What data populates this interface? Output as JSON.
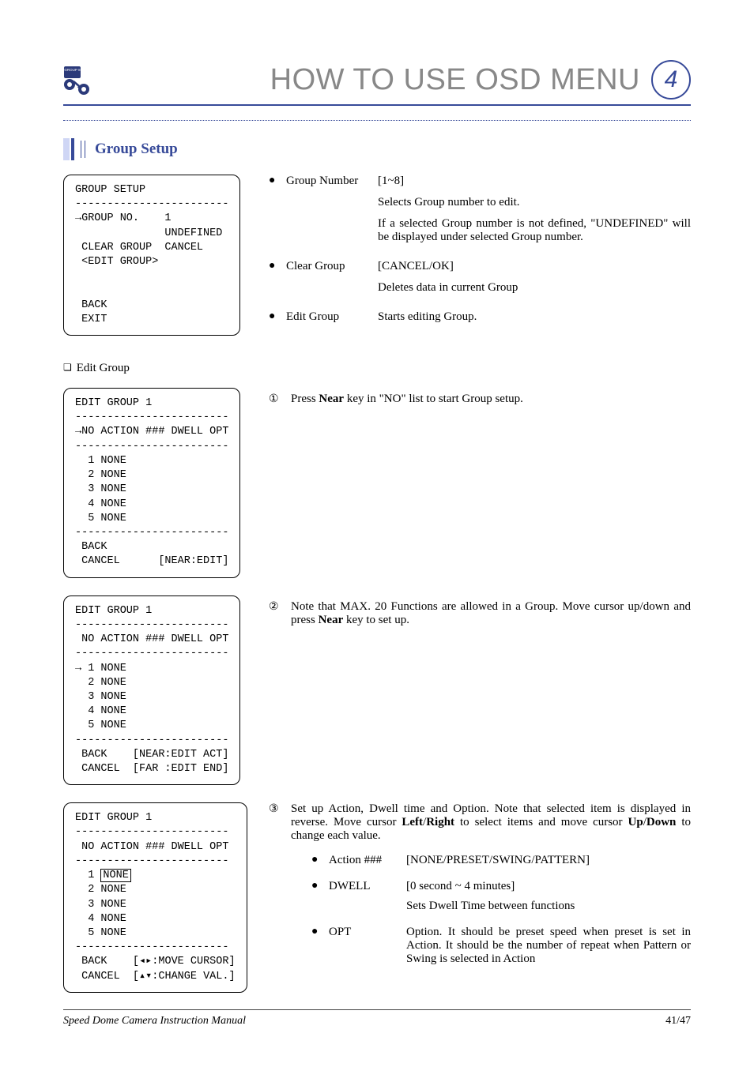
{
  "header": {
    "title": "HOW TO USE OSD MENU",
    "chapter_number": "4",
    "icon_name": "group-8-icon"
  },
  "section": {
    "title": "Group Setup"
  },
  "osd_group_setup": {
    "title": "GROUP SETUP",
    "rule": "------------------------",
    "row_no": "→GROUP NO.    1",
    "row_undef": "              UNDEFINED",
    "row_clear": " CLEAR GROUP  CANCEL",
    "row_edit": " <EDIT GROUP>",
    "row_back": " BACK",
    "row_exit": " EXIT"
  },
  "group_desc": {
    "items": [
      {
        "label": "Group Number",
        "value_line": "[1~8]",
        "p1": "Selects Group number to edit.",
        "p2": "If a selected  Group number is not defined, \"UNDEFINED\" will be displayed under selected Group number."
      },
      {
        "label": "Clear Group",
        "value_line": "[CANCEL/OK]",
        "p1": "Deletes data in current Group"
      },
      {
        "label": "Edit Group",
        "value_line": "Starts editing Group."
      }
    ]
  },
  "subheading": "Edit Group",
  "osd_edit1": {
    "title": "EDIT GROUP 1",
    "rule": "------------------------",
    "hdr": "→NO ACTION ### DWELL OPT",
    "rows": "  1 NONE\n  2 NONE\n  3 NONE\n  4 NONE\n  5 NONE",
    "back": " BACK",
    "cancel": " CANCEL      [NEAR:EDIT]"
  },
  "osd_edit2": {
    "title": "EDIT GROUP 1",
    "rule": "------------------------",
    "hdr": " NO ACTION ### DWELL OPT",
    "rows": "→ 1 NONE\n  2 NONE\n  3 NONE\n  4 NONE\n  5 NONE",
    "back": " BACK    [NEAR:EDIT ACT]",
    "cancel": " CANCEL  [FAR :EDIT END]"
  },
  "osd_edit3": {
    "title": "EDIT GROUP 1",
    "rule": "------------------------",
    "hdr": " NO ACTION ### DWELL OPT",
    "row1_pre": "  1 ",
    "row1_boxed": "NONE",
    "rows_rest": "  2 NONE\n  3 NONE\n  4 NONE\n  5 NONE",
    "back": " BACK    [◂▸:MOVE CURSOR]",
    "cancel": " CANCEL  [▴▾:CHANGE VAL.]"
  },
  "steps": {
    "s1": {
      "num": "①",
      "txt_pre": "Press ",
      "bold": "Near",
      "txt_post": " key in \"NO\" list to start Group setup."
    },
    "s2": {
      "num": "②",
      "txt_pre": "Note that MAX. 20 Functions are allowed in a Group. Move cursor up/down and press ",
      "bold": "Near",
      "txt_post": " key to set up."
    },
    "s3": {
      "num": "③",
      "p1_a": "Set up Action, Dwell time and Option. Note that selected item is displayed in reverse. Move cursor ",
      "b1": "Left",
      "p1_b": "/",
      "b2": "Right",
      "p1_c": " to select items and move cursor ",
      "b3": "Up",
      "p1_d": "/",
      "b4": "Down",
      "p1_e": " to change each value."
    }
  },
  "params": {
    "items": [
      {
        "label": "Action ###",
        "line1": "[NONE/PRESET/SWING/PATTERN]"
      },
      {
        "label": "DWELL",
        "line1": "[0 second ~ 4 minutes]",
        "line2": "Sets Dwell Time between functions"
      },
      {
        "label": "OPT",
        "line1": "Option. It should be preset speed when preset is set in Action. It should be the number of repeat when Pattern or Swing is selected in Action"
      }
    ]
  },
  "footer": {
    "left": "Speed Dome Camera Instruction Manual",
    "right": "41/47"
  }
}
